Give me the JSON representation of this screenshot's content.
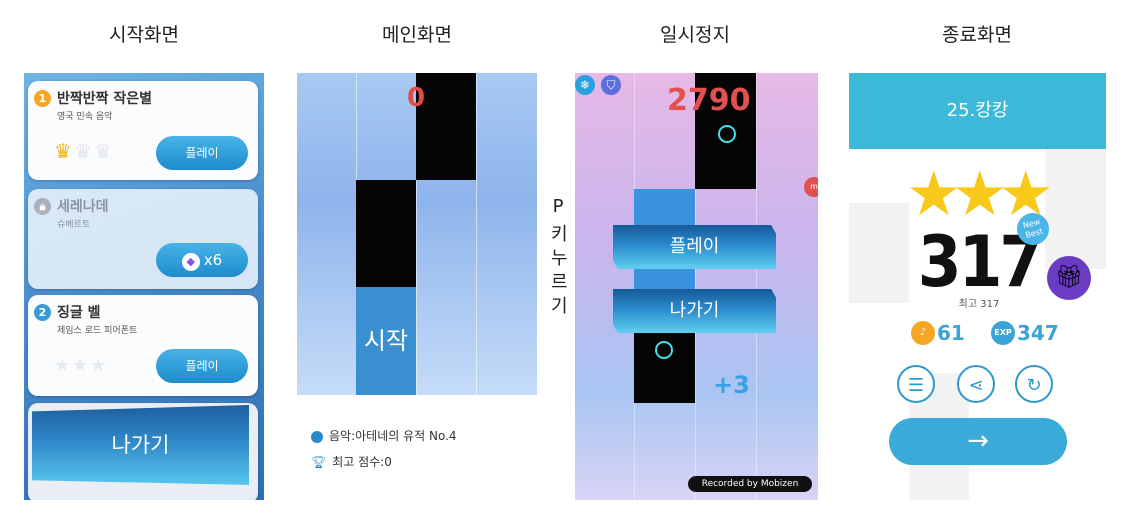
{
  "captions": {
    "start": "시작화면",
    "main": "메인화면",
    "pause": "일시정지",
    "end": "종료화면",
    "p_key": [
      "P",
      "키",
      "누",
      "르",
      "기"
    ]
  },
  "start_screen": {
    "songs": [
      {
        "number": "1",
        "title": "반짝반짝 작은별",
        "subtitle": "영국 민속 음악",
        "button": "플레이",
        "crowns_earned": 1,
        "crowns_total": 3
      },
      {
        "title": "세레나데",
        "subtitle": "슈베르트",
        "button_cost": "x6",
        "locked": true
      },
      {
        "number": "2",
        "title": "징글 벨",
        "subtitle": "제임스 로드 피어폰트",
        "button": "플레이",
        "stars_earned": 0,
        "stars_total": 3
      }
    ],
    "exit_button": "나가기"
  },
  "main_screen": {
    "score": "0",
    "start_tile": "시작",
    "music_info": "음악:아테네의 유적 No.4",
    "best_score": "최고 점수:0"
  },
  "pause_screen": {
    "score": "2790",
    "play_button": "플레이",
    "exit_button": "나가기",
    "bonus": "+3",
    "recorder": "Recorded by Mobizen"
  },
  "end_screen": {
    "song_title": "25.캉캉",
    "stars": 3,
    "score": "317",
    "new_best": "New Best",
    "best": "최고 317",
    "notes": "61",
    "exp_label": "EXP",
    "exp": "347",
    "next_arrow": "→"
  },
  "colors": {
    "accent": "#3cb8d8",
    "score_red": "#e54848",
    "star": "#f8c81a"
  }
}
